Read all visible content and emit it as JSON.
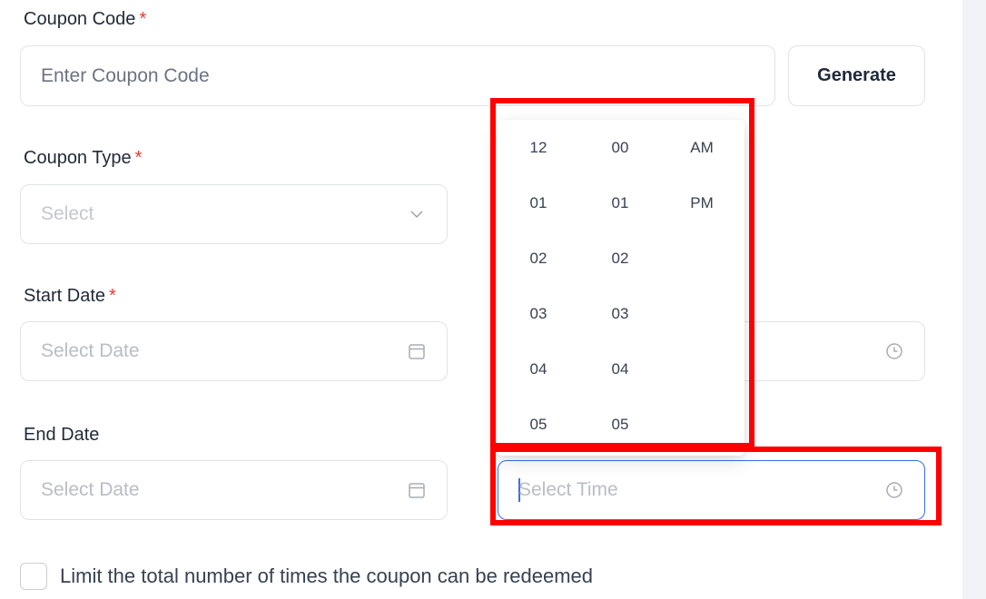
{
  "coupon_code": {
    "label": "Coupon Code",
    "required_mark": "*",
    "placeholder": "Enter Coupon Code",
    "generate_label": "Generate"
  },
  "coupon_type": {
    "label": "Coupon Type",
    "required_mark": "*",
    "placeholder": "Select"
  },
  "start_date": {
    "label": "Start Date",
    "required_mark": "*",
    "placeholder": "Select Date"
  },
  "end_date": {
    "label": "End Date",
    "placeholder": "Select Date"
  },
  "end_time": {
    "placeholder": "Select Time"
  },
  "time_picker": {
    "hours": [
      "12",
      "01",
      "02",
      "03",
      "04",
      "05"
    ],
    "minutes": [
      "00",
      "01",
      "02",
      "03",
      "04",
      "05"
    ],
    "meridiem": [
      "AM",
      "PM"
    ]
  },
  "limit_checkbox": {
    "label": "Limit the total number of times the coupon can be redeemed"
  },
  "colors": {
    "highlight": "#ff0000",
    "focus": "#3b6cf6",
    "required": "#e53935"
  }
}
